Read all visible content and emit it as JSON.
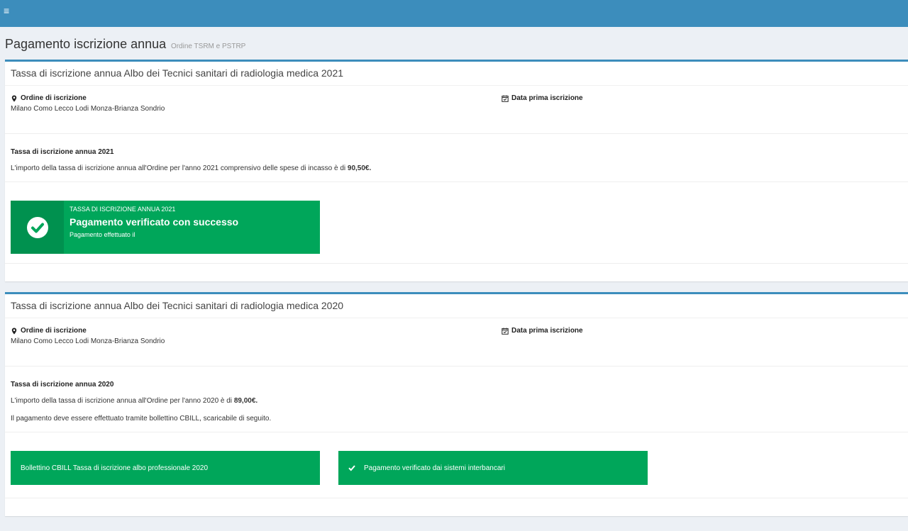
{
  "header": {
    "title": "Pagamento iscrizione annua",
    "subtitle": "Ordine TSRM e PSTRP"
  },
  "colors": {
    "topbar": "#3c8dbc",
    "success": "#00a65a",
    "background": "#ecf0f5"
  },
  "boxes": [
    {
      "title": "Tassa di iscrizione annua Albo dei Tecnici sanitari di radiologia medica 2021",
      "ordine_label": "Ordine di iscrizione",
      "ordine_value": "Milano Como Lecco Lodi Monza-Brianza Sondrio",
      "data_label": "Data prima iscrizione",
      "fee_title": "Tassa di iscrizione annua 2021",
      "fee_text_prefix": "L'importo della tassa di iscrizione annua all'Ordine per l'anno 2021 comprensivo delle spese di incasso è di ",
      "fee_amount": "90,50€.",
      "status_small": "TASSA DI ISCRIZIONE ANNUA 2021",
      "status_big": "Pagamento verificato con successo",
      "status_sub": "Pagamento effettuato il"
    },
    {
      "title": "Tassa di iscrizione annua Albo dei Tecnici sanitari di radiologia medica 2020",
      "ordine_label": "Ordine di iscrizione",
      "ordine_value": "Milano Como Lecco Lodi Monza-Brianza Sondrio",
      "data_label": "Data prima iscrizione",
      "fee_title": "Tassa di iscrizione annua 2020",
      "fee_text_prefix": "L'importo della tassa di iscrizione annua all'Ordine per l'anno 2020 è di ",
      "fee_amount": "89,00€.",
      "fee_text2": "Il pagamento deve essere effettuato tramite bollettino CBILL, scaricabile di seguito.",
      "cbill_button": "Bollettino CBILL Tassa di iscrizione albo professionale 2020",
      "verified_button": "Pagamento verificato dai sistemi interbancari"
    }
  ]
}
